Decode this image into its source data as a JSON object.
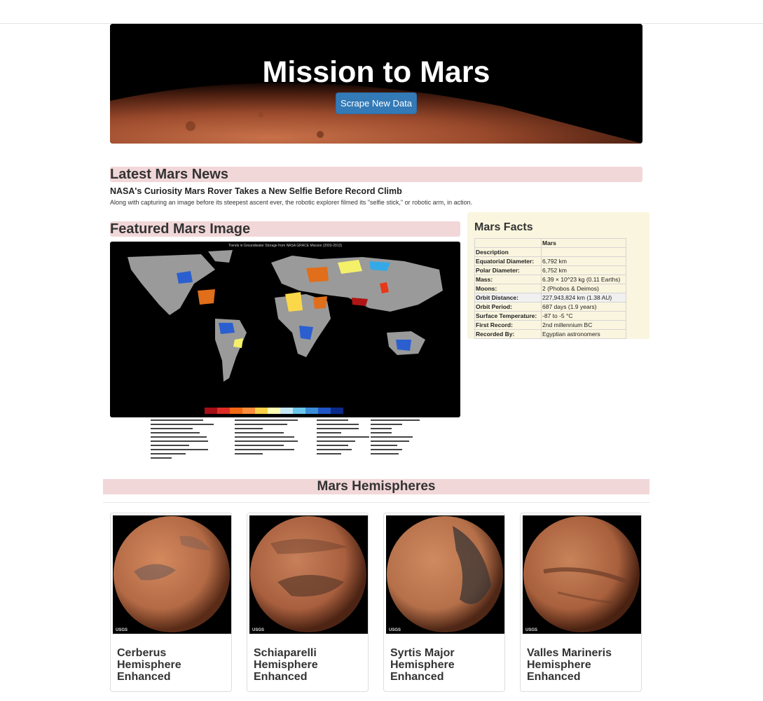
{
  "header": {
    "title": "Mission to Mars",
    "scrape_button": "Scrape New Data"
  },
  "news": {
    "heading": "Latest Mars News",
    "title": "NASA's Curiosity Mars Rover Takes a New Selfie Before Record Climb",
    "teaser": "Along with capturing an image before its steepest ascent ever, the robotic explorer filmed its \"selfie stick,\" or robotic arm, in action."
  },
  "featured": {
    "heading": "Featured Mars Image",
    "image_title": "Trends in Groundwater Storage from NASA GRACE Mission (2003-2013)"
  },
  "facts": {
    "heading": "Mars Facts",
    "column_header": "Mars",
    "rows": [
      {
        "k": "Description",
        "v": ""
      },
      {
        "k": "Equatorial Diameter:",
        "v": "6,792 km"
      },
      {
        "k": "Polar Diameter:",
        "v": "6,752 km"
      },
      {
        "k": "Mass:",
        "v": "6.39 × 10^23 kg (0.11 Earths)"
      },
      {
        "k": "Moons:",
        "v": "2 (Phobos & Deimos)"
      },
      {
        "k": "Orbit Distance:",
        "v": "227,943,824 km (1.38 AU)"
      },
      {
        "k": "Orbit Period:",
        "v": "687 days (1.9 years)"
      },
      {
        "k": "Surface Temperature:",
        "v": "-87 to -5 °C"
      },
      {
        "k": "First Record:",
        "v": "2nd millennium BC"
      },
      {
        "k": "Recorded By:",
        "v": "Egyptian astronomers"
      }
    ]
  },
  "hemispheres": {
    "heading": "Mars Hemispheres",
    "items": [
      {
        "title": "Cerberus Hemisphere Enhanced",
        "base": "#b36a45",
        "dark": "#6f5a55"
      },
      {
        "title": "Schiaparelli Hemisphere Enhanced",
        "base": "#a85f3e",
        "dark": "#5e3a2a"
      },
      {
        "title": "Syrtis Major Hemisphere Enhanced",
        "base": "#b5704a",
        "dark": "#3b3634"
      },
      {
        "title": "Valles Marineris Hemisphere Enhanced",
        "base": "#a8603d",
        "dark": "#6b3c28"
      }
    ],
    "logo_text": "USGS"
  }
}
